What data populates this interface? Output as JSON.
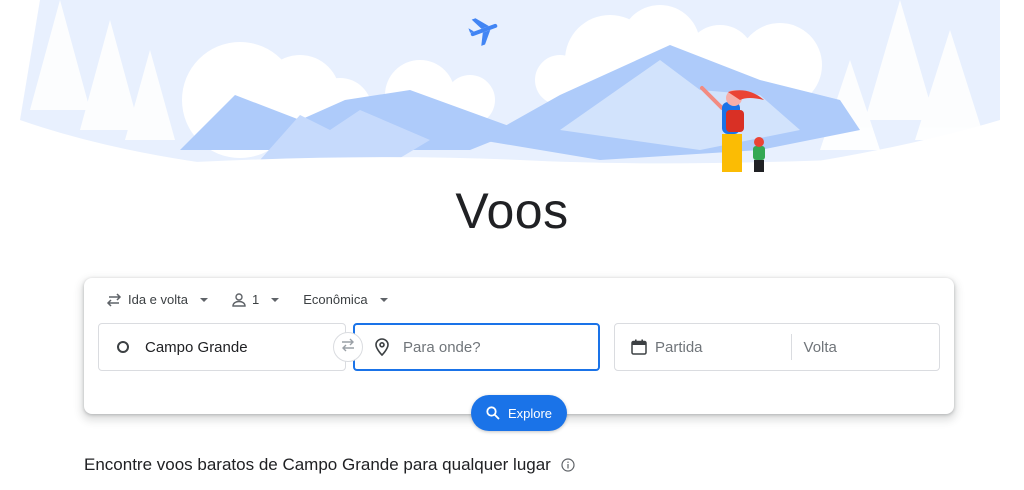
{
  "page_title": "Voos",
  "trip_options": {
    "trip_type": "Ida e volta",
    "passengers": "1",
    "cabin_class": "Econômica"
  },
  "search": {
    "origin_value": "Campo Grande",
    "destination_placeholder": "Para onde?",
    "departure_placeholder": "Partida",
    "return_placeholder": "Volta"
  },
  "explore_button": {
    "label": "Explore"
  },
  "section_heading": "Encontre voos baratos de Campo Grande para qualquer lugar",
  "colors": {
    "accent": "#1a73e8",
    "sky": "#e8f0fe",
    "mountain": "#aecbfa"
  },
  "icons": [
    "roundtrip-icon",
    "person-icon",
    "origin-circle-icon",
    "swap-icon",
    "location-pin-icon",
    "calendar-icon",
    "search-icon",
    "info-icon"
  ]
}
